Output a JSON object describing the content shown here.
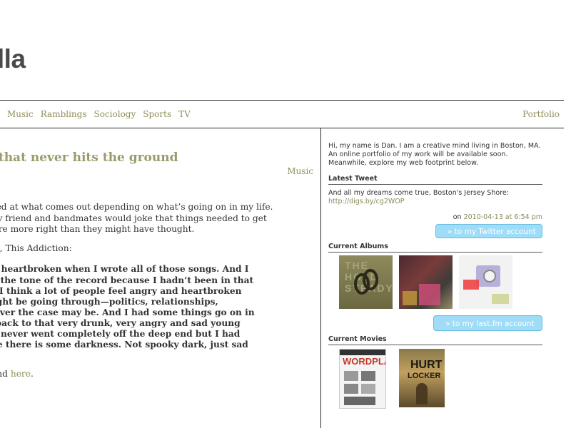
{
  "site": {
    "title": "billa"
  },
  "nav": {
    "items": [
      "Music",
      "Ramblings",
      "Sociology",
      "Sports",
      "TV"
    ],
    "right": "Portfolio"
  },
  "post": {
    "title": "sh that never hits the ground",
    "category": "Music",
    "para1_line1": "s been amazed at what comes out depending on what’s going on in my life.",
    "para1_line2": "ell for me, my friend and bandmates would joke that things needed to get",
    "para1_line3": "ffer.  They were more right than they might have thought.",
    "para2": "’s new album, This Addiction:",
    "quote_lines": [
      "angst-y and heartbroken when I wrote all of those songs. And I",
      "t to do with the tone of the record because I hadn’t been in that",
      "for a while. I think a lot of people feel angry and heartbroken",
      "t is they might be going through—politics, relationships,",
      "ying—whatever the case may be. And I had some things go on in",
      "rought me back to that very drunk, very angry and sad young",
      "years ago. I never went completely off the deep end but I had",
      "nd therefore there is some darkness. Not spooky dark, just sad"
    ],
    "footer_text": "n be found ",
    "footer_link": "here",
    "footer_end": "."
  },
  "sidebar": {
    "intro": "Hi, my name is Dan. I am a creative mind living in Boston, MA. An online portfolio of my work will be available soon. Meanwhile, explore my web footprint below.",
    "latest_tweet": {
      "heading": "Latest Tweet",
      "text": "And all my dreams come true, Boston's Jersey Shore:",
      "link": "http://digs.by/cg2WOP",
      "on": "on",
      "date": "2010-04-13 at 6:54 pm",
      "button": "» to my Twitter account"
    },
    "albums": {
      "heading": "Current Albums",
      "button": "» to my last.fm account"
    },
    "movies": {
      "heading": "Current Movies"
    }
  },
  "colors": {
    "accent": "#8f8f5a",
    "button": "#9fdcf7",
    "divider": "#2b2b2b"
  }
}
